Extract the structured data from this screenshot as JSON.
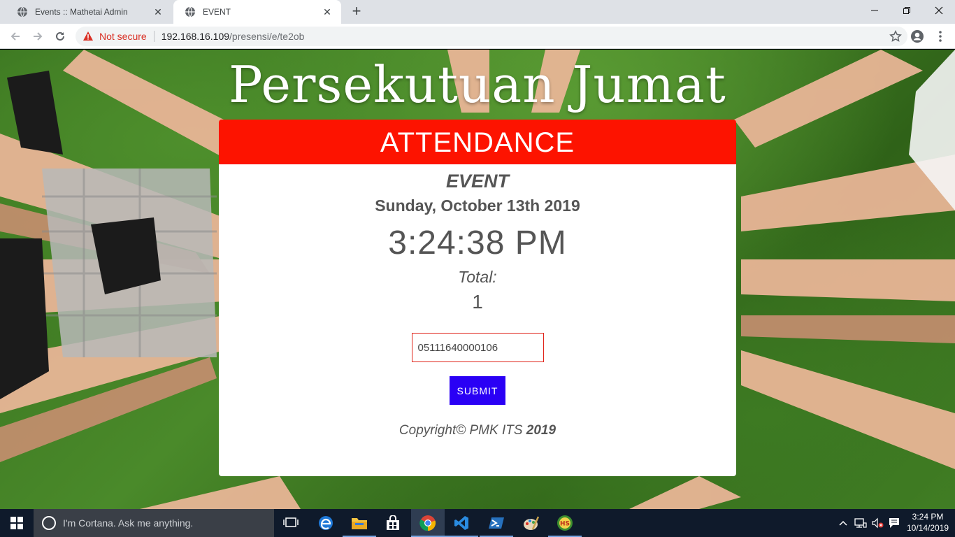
{
  "browser": {
    "tabs": [
      {
        "title": "Events :: Mathetai Admin",
        "active": false
      },
      {
        "title": "EVENT",
        "active": true
      }
    ],
    "security_label": "Not secure",
    "url_host": "192.168.16.109",
    "url_path": "/presensi/e/te2ob"
  },
  "page": {
    "site_title": "Persekutuan Jumat",
    "header": "ATTENDANCE",
    "event_name": "EVENT",
    "event_date": "Sunday, October 13th 2019",
    "current_time": "3:24:38 PM",
    "total_label": "Total:",
    "total_value": "1",
    "nrp_input_value": "05111640000106",
    "submit_label": "SUBMIT",
    "copyright_text": "Copyright© PMK ITS ",
    "copyright_year": "2019"
  },
  "taskbar": {
    "search_placeholder": "I'm Cortana. Ask me anything.",
    "time": "3:24 PM",
    "date": "10/14/2019",
    "pinned": [
      "task-view-icon",
      "edge-icon",
      "file-explorer-icon",
      "store-icon",
      "chrome-icon",
      "vscode-icon",
      "powershell-icon",
      "paint-icon",
      "hs-app-icon"
    ]
  },
  "colors": {
    "header_red": "#fd1300",
    "submit_blue": "#2a00f5",
    "input_border": "#e0241a",
    "text_gray": "#555555"
  }
}
